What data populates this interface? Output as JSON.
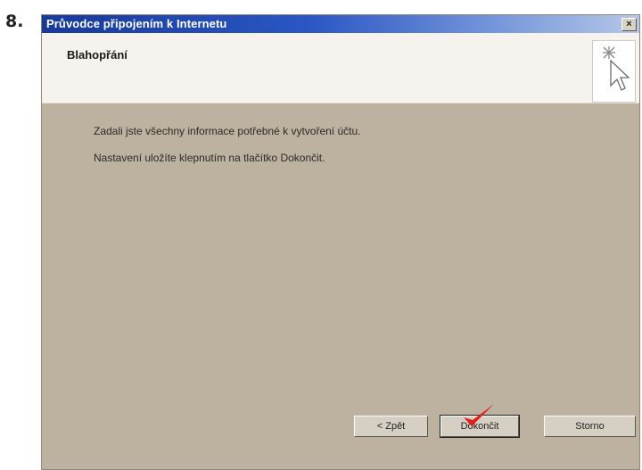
{
  "step_label": "8.",
  "window": {
    "title": "Průvodce připojením k Internetu",
    "close_glyph": "×"
  },
  "header": {
    "title": "Blahopřání",
    "icon": "wizard-cursor-icon"
  },
  "content": {
    "line1": "Zadali jste všechny informace potřebné k vytvoření účtu.",
    "line2": "Nastavení uložíte klepnutím na tlačítko Dokončit."
  },
  "buttons": {
    "back": "< Zpět",
    "finish": "Dokončit",
    "cancel": "Storno"
  },
  "annotation": {
    "icon": "check-mark-icon",
    "color": "#e02020"
  }
}
